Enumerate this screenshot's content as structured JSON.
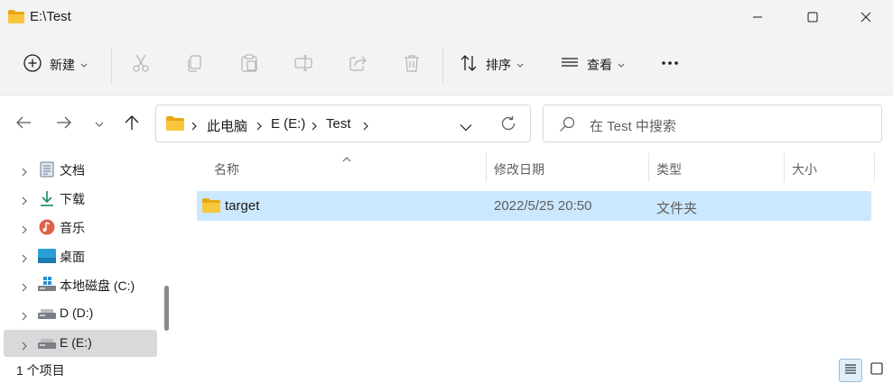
{
  "window": {
    "title": "E:\\Test"
  },
  "toolbar": {
    "new_label": "新建",
    "sort_label": "排序",
    "view_label": "查看"
  },
  "breadcrumb": {
    "items": [
      "此电脑",
      "E (E:)",
      "Test"
    ]
  },
  "search": {
    "placeholder": "在 Test 中搜索"
  },
  "sidebar": {
    "items": [
      {
        "label": "文档",
        "icon": "documents-icon"
      },
      {
        "label": "下载",
        "icon": "download-icon"
      },
      {
        "label": "音乐",
        "icon": "music-icon"
      },
      {
        "label": "桌面",
        "icon": "desktop-icon"
      },
      {
        "label": "本地磁盘 (C:)",
        "icon": "drive-icon"
      },
      {
        "label": "D (D:)",
        "icon": "drive-icon"
      },
      {
        "label": "E (E:)",
        "icon": "drive-icon",
        "selected": true
      }
    ]
  },
  "table": {
    "columns": [
      "名称",
      "修改日期",
      "类型",
      "大小"
    ],
    "rows": [
      {
        "name": "target",
        "modified": "2022/5/25 20:50",
        "type": "文件夹",
        "size": ""
      }
    ]
  },
  "status": {
    "text": "1 个项目"
  },
  "colors": {
    "folder": "#f8c63c",
    "selection": "#cce8ff",
    "accent": "#005fb8",
    "chrome": "#f3f3f3"
  }
}
